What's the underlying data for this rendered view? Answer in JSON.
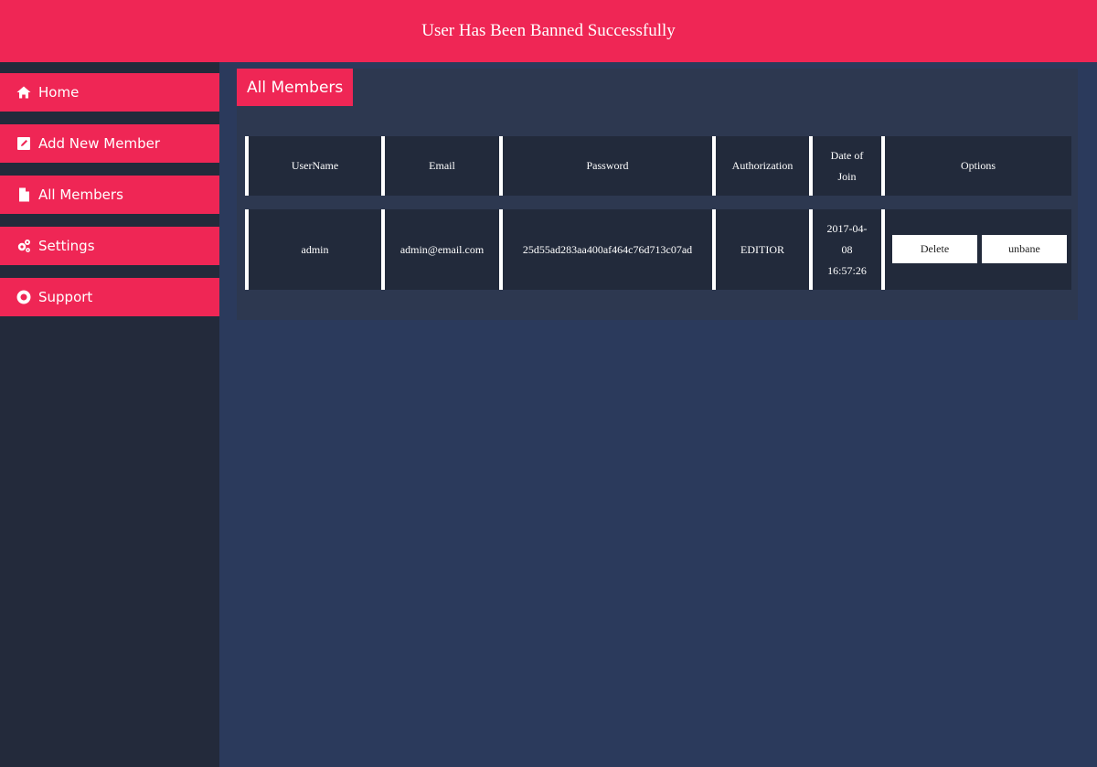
{
  "banner": {
    "message": "User Has Been Banned Successfully"
  },
  "sidebar": {
    "items": [
      {
        "label": "Home",
        "icon": "home-icon"
      },
      {
        "label": "Add New Member",
        "icon": "edit-icon"
      },
      {
        "label": "All Members",
        "icon": "file-icon"
      },
      {
        "label": "Settings",
        "icon": "gears-icon"
      },
      {
        "label": "Support",
        "icon": "life-ring-icon"
      }
    ]
  },
  "panel": {
    "title": "All Members"
  },
  "table": {
    "headers": {
      "username": "UserName",
      "email": "Email",
      "password": "Password",
      "authorization": "Authorization",
      "date_line1": "Date of",
      "date_line2": "Join",
      "options": "Options"
    },
    "rows": [
      {
        "username": "admin",
        "email": "admin@email.com",
        "password": "25d55ad283aa400af464c76d713c07ad",
        "authorization": "EDITIOR",
        "date_line1": "2017-04-",
        "date_line2": "08",
        "date_line3": "16:57:26",
        "delete_label": "Delete",
        "unban_label": "unbane"
      }
    ]
  },
  "colors": {
    "accent": "#ef2655",
    "sidebar_bg": "#232a3b",
    "page_bg": "#2b3a5c",
    "cell_bg": "#222a3b"
  }
}
